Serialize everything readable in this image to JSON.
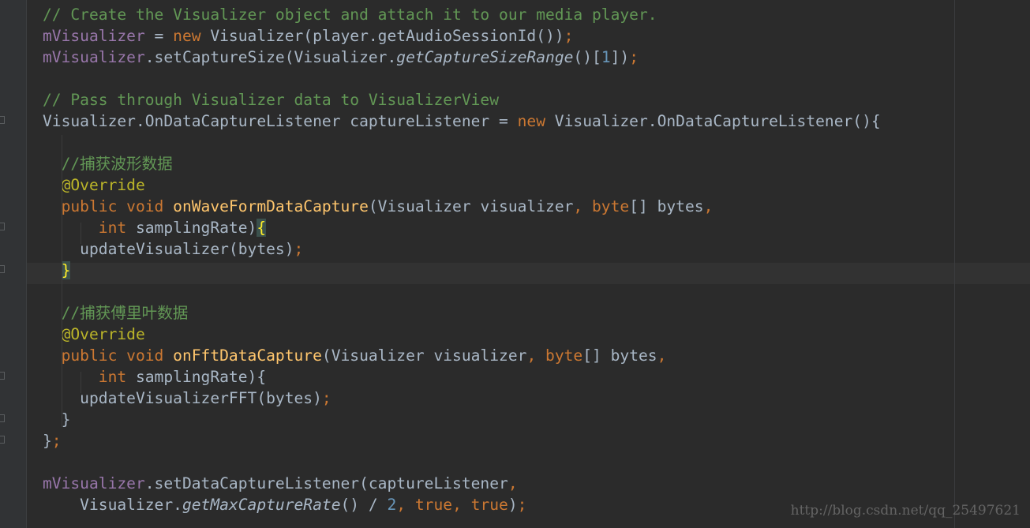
{
  "editor": {
    "watermark": "http://blog.csdn.net/qq_25497621",
    "lines": [
      "// Create the Visualizer object and attach it to our media player.",
      "mVisualizer = new Visualizer(player.getAudioSessionId());",
      "mVisualizer.setCaptureSize(Visualizer.getCaptureSizeRange()[1]);",
      "",
      "// Pass through Visualizer data to VisualizerView",
      "Visualizer.OnDataCaptureListener captureListener = new Visualizer.OnDataCaptureListener(){",
      "",
      "  //捕获波形数据",
      "  @Override",
      "  public void onWaveFormDataCapture(Visualizer visualizer, byte[] bytes,",
      "      int samplingRate){",
      "    updateVisualizer(bytes);",
      "  }",
      "",
      "  //捕获傅里叶数据",
      "  @Override",
      "  public void onFftDataCapture(Visualizer visualizer, byte[] bytes,",
      "      int samplingRate){",
      "    updateVisualizerFFT(bytes);",
      "  }",
      "};",
      "",
      "mVisualizer.setDataCaptureListener(captureListener,",
      "    Visualizer.getMaxCaptureRate() / 2, true, true);"
    ]
  },
  "colors": {
    "background": "#2b2b2b",
    "keyword": "#cc7832",
    "field": "#9876aa",
    "method": "#ffc66d",
    "comment": "#629755",
    "annotation": "#bbb529",
    "number": "#6897bb",
    "text": "#a9b7c6"
  }
}
